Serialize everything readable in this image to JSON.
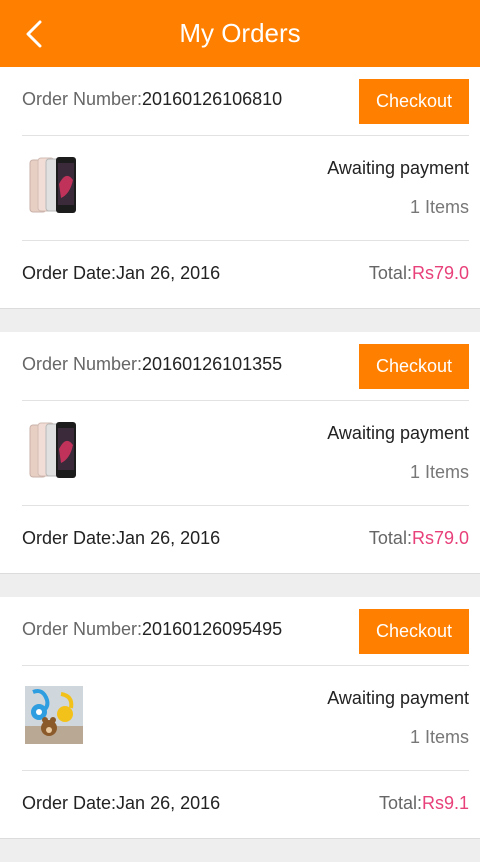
{
  "header": {
    "title": "My Orders",
    "back_icon": "back-chevron-icon"
  },
  "colors": {
    "accent": "#ff7f00",
    "price": "#e8407a",
    "background": "#eeeeee"
  },
  "orders": [
    {
      "order_label": "Order Number:",
      "order_number": "20160126106810",
      "checkout_label": "Checkout",
      "thumbnail": "iphone-product-image",
      "status": "Awaiting payment",
      "items": "1 Items",
      "date_label": "Order Date:",
      "date": "Jan 26, 2016",
      "total_label": "Total:",
      "total": "Rs79.0"
    },
    {
      "order_label": "Order Number:",
      "order_number": "20160126101355",
      "checkout_label": "Checkout",
      "thumbnail": "iphone-product-image",
      "status": "Awaiting payment",
      "items": "1 Items",
      "date_label": "Order Date:",
      "date": "Jan 26, 2016",
      "total_label": "Total:",
      "total": "Rs79.0"
    },
    {
      "order_label": "Order Number:",
      "order_number": "20160126095495",
      "checkout_label": "Checkout",
      "thumbnail": "cartoon-cable-product-image",
      "status": "Awaiting payment",
      "items": "1 Items",
      "date_label": "Order Date:",
      "date": "Jan 26, 2016",
      "total_label": "Total:",
      "total": "Rs9.1"
    }
  ]
}
